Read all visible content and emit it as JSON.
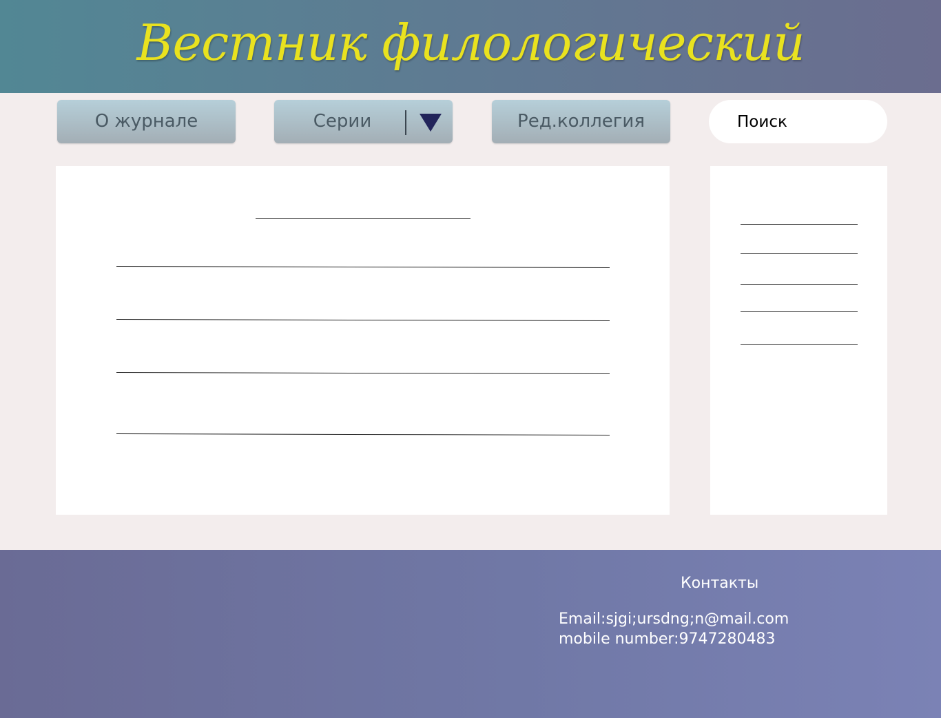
{
  "header": {
    "title": "Вестник филологический",
    "title_color": "#e9e21f"
  },
  "nav": {
    "about_label": "О журнале",
    "series_label": "Серии",
    "board_label": "Ред.коллегия"
  },
  "search": {
    "placeholder": "Поиск"
  },
  "footer": {
    "contacts_title": "Контакты",
    "email": "Email:sjgi;ursdng;n@mail.com",
    "phone": "mobile number:9747280483"
  }
}
